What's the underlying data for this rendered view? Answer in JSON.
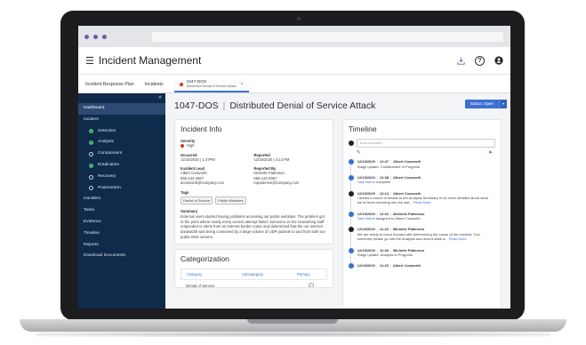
{
  "app": {
    "title": "Incident Management",
    "icons": [
      "download-icon",
      "help-icon",
      "user-icon"
    ]
  },
  "tabs": [
    {
      "label": "Incident Response Plan"
    },
    {
      "label": "Incidents"
    },
    {
      "id": "1047-DOS",
      "sublabel": "Distributed Denial of Service Attack",
      "close": "×",
      "active": true
    }
  ],
  "sidebar": {
    "collapse": "«",
    "items": [
      {
        "label": "Dashboard",
        "active": true
      },
      {
        "label": "Incident"
      },
      {
        "label": "Detection",
        "sub": true,
        "state": "done"
      },
      {
        "label": "Analysis",
        "sub": true,
        "state": "done"
      },
      {
        "label": "Containment",
        "sub": true,
        "state": "open"
      },
      {
        "label": "Eradication",
        "sub": true,
        "state": "done"
      },
      {
        "label": "Recovery",
        "sub": true,
        "state": "open"
      },
      {
        "label": "Postmortem",
        "sub": true,
        "state": "open"
      },
      {
        "label": "Handlers"
      },
      {
        "label": "Tasks"
      },
      {
        "label": "Evidence"
      },
      {
        "label": "Timeline"
      },
      {
        "label": "Reports"
      },
      {
        "label": "Download Documents"
      }
    ]
  },
  "incident": {
    "id": "1047-DOS",
    "name": "Distributed Denial of Service Attack",
    "status_label": "Status: Open",
    "status_caret": "▾"
  },
  "info": {
    "title": "Incident Info",
    "severity_label": "Severity",
    "severity_value": "High",
    "occurred_label": "Occurred",
    "occurred_value": "12/16/2020 | 1:47PM",
    "reported_label": "Reported",
    "reported_value": "12/16/2020 | 4:14 PM",
    "lead_label": "Incident Lead",
    "lead_name": "Albert Cosworth",
    "lead_phone": "555-123-4567",
    "lead_email": "acosworth@company.com",
    "reporter_label": "Reported By",
    "reporter_name": "Michelle Patterson",
    "reporter_phone": "555-123-4567",
    "reporter_email": "mpatterson@company.com",
    "tags_label": "Tags",
    "tags": [
      "Denial of Service",
      "Public Websites"
    ],
    "summary_label": "Summary",
    "summary": "External users started having problems accessing our public websites. The problem got to the point where nearly every access attempt failed. Someone on the networking staff responded to alerts from an Internet border router and determined that the our Internet bandwidth was being consumed by a large volume of UDP packets to and from both our public DNS servers."
  },
  "categorization": {
    "title": "Categorization",
    "headers": [
      "Category",
      "Subcategory",
      "Primary"
    ],
    "rows": [
      {
        "category": "Denial of Service",
        "subcategory": "",
        "primary": "✓"
      }
    ]
  },
  "timeline": {
    "title": "Timeline",
    "placeholder": "Add comment...",
    "entries": [
      {
        "date": "12/19/2020",
        "time": "12:47",
        "user": "Albert Cosworth",
        "text": "Stage update: Containment In Progress",
        "link": "",
        "after": "",
        "kind": "stage"
      },
      {
        "date": "12/19/2020",
        "time": "12:38",
        "user": "Albert Cosworth",
        "text": "",
        "link": "Task Name",
        "after": " complete",
        "kind": "stage"
      },
      {
        "date": "12/19/2020",
        "time": "12:14",
        "user": "Albert Cosworth",
        "text": "I added a bunch of details to the Analysis Summary to be more detailed about what we've been checking into the last...",
        "link": "Read More",
        "after": "",
        "kind": "user"
      },
      {
        "date": "12/19/2020",
        "time": "12:01",
        "user": "Michelle Patterson",
        "text": "",
        "link": "Task Name",
        "after": " assigned to Albert Cosworth",
        "kind": "stage"
      },
      {
        "date": "12/19/2020",
        "time": "11:43",
        "user": "Michelle Patterson",
        "text": "We are ready to move forward with determining the cause of the incident. Can someone please go into the Analysis and record what w...",
        "link": "Read More",
        "after": "",
        "kind": "user"
      },
      {
        "date": "12/19/2020",
        "time": "11:38",
        "user": "Michelle Patterson",
        "text": "Stage update: Analysis in Progress",
        "link": "",
        "after": "",
        "kind": "stage"
      },
      {
        "date": "12/19/2020",
        "time": "11:25",
        "user": "Albert Cosworth",
        "text": "",
        "link": "",
        "after": "",
        "kind": "stage"
      }
    ]
  },
  "colors": {
    "sidebar": "#102a4c",
    "accent": "#3c6fd1",
    "severity_high": "#d9342b",
    "done": "#3fbf6c"
  }
}
